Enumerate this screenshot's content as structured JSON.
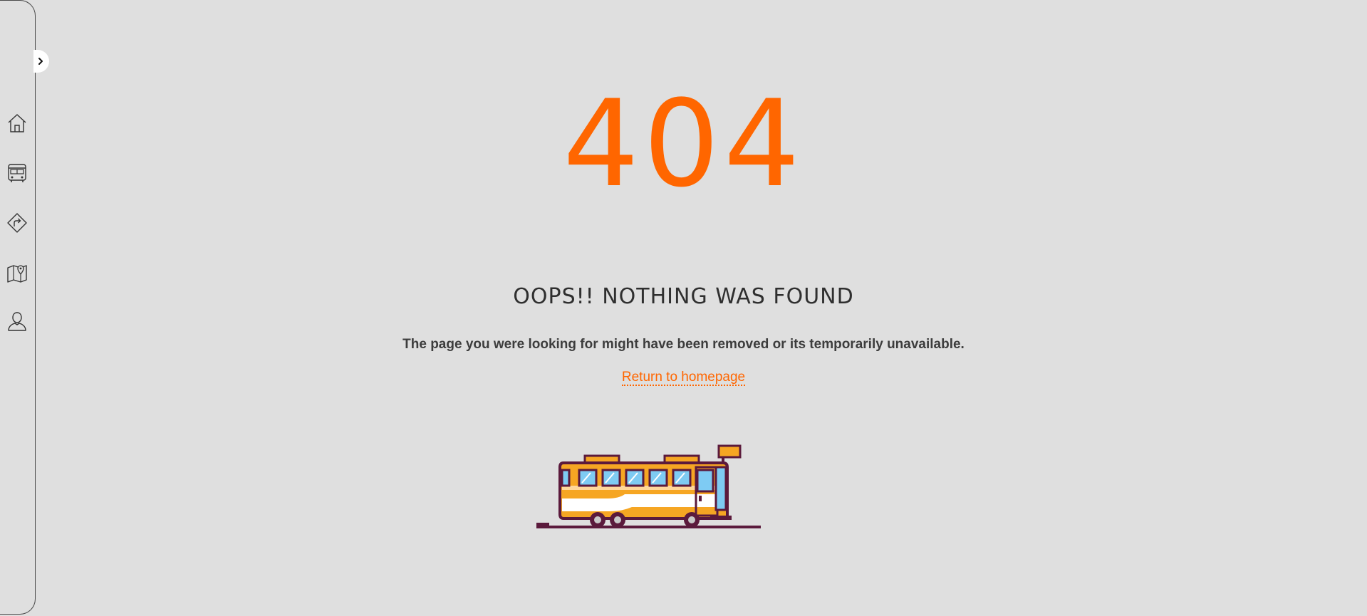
{
  "sidebar": {
    "toggle_icon": "chevron-right-icon",
    "items": [
      {
        "name": "home",
        "icon": "home-icon"
      },
      {
        "name": "bus",
        "icon": "bus-icon"
      },
      {
        "name": "route",
        "icon": "route-icon"
      },
      {
        "name": "map",
        "icon": "map-icon"
      },
      {
        "name": "profile",
        "icon": "user-icon"
      }
    ]
  },
  "error": {
    "code": "404",
    "headline": "OOPS!! NOTHING WAS FOUND",
    "message": "The page you were looking for might have been removed or its temporarily unavailable.",
    "link_label": "Return to homepage"
  },
  "colors": {
    "accent": "#ff6600",
    "background": "#dfdfdf",
    "text": "#2f2f2f"
  }
}
